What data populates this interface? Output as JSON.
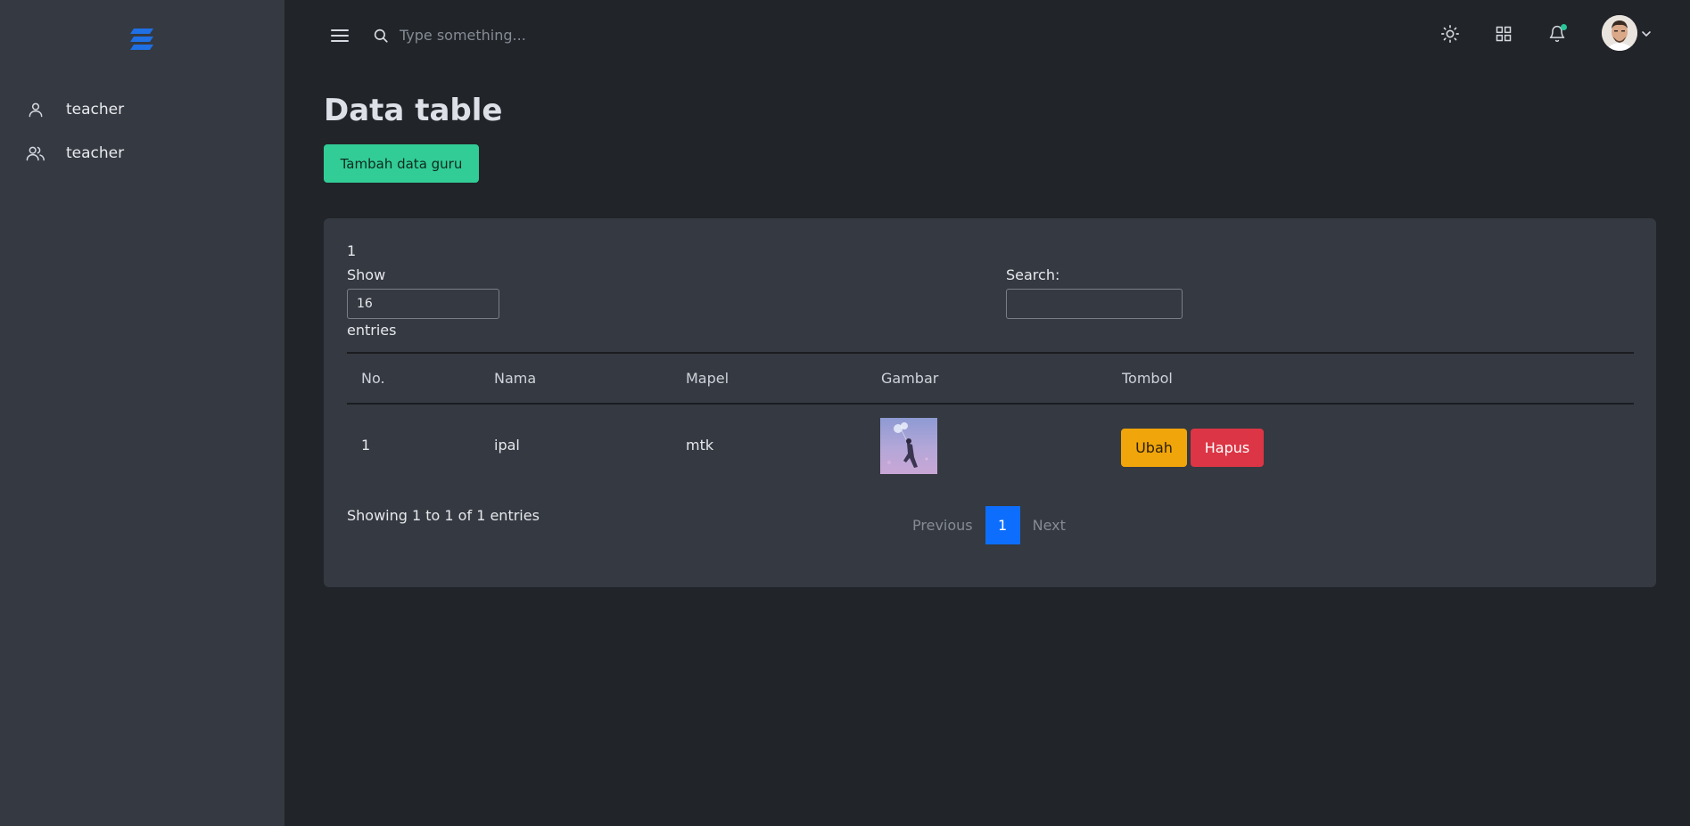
{
  "sidebar": {
    "items": [
      {
        "label": "teacher",
        "icon": "user-icon"
      },
      {
        "label": "teacher",
        "icon": "users-icon"
      }
    ]
  },
  "header": {
    "search_placeholder": "Type something..."
  },
  "page": {
    "title": "Data table",
    "add_button": "Tambah data guru"
  },
  "datatable": {
    "top_text": "1",
    "show_label": "Show",
    "length_value": "16",
    "entries_label": "entries",
    "search_label": "Search:",
    "columns": [
      "No.",
      "Nama",
      "Mapel",
      "Gambar",
      "Tombol"
    ],
    "rows": [
      {
        "no": "1",
        "nama": "ipal",
        "mapel": "mtk",
        "edit_label": "Ubah",
        "delete_label": "Hapus"
      }
    ],
    "info": "Showing 1 to 1 of 1 entries",
    "pagination": {
      "previous": "Previous",
      "current": "1",
      "next": "Next"
    }
  },
  "colors": {
    "accent_green": "#32cc96",
    "primary_blue": "#0d6efd",
    "warning": "#f0a50b",
    "danger": "#dc3545"
  }
}
